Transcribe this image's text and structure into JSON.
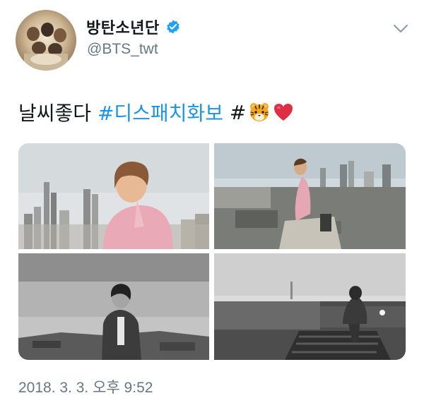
{
  "tweet": {
    "display_name": "방탄소년단",
    "handle": "@BTS_twt",
    "text_plain": "날씨좋다",
    "hashtag_1": "#디스패치화보",
    "hashtag_2": "#",
    "emojis": [
      "tiger-face",
      "red-heart"
    ],
    "timestamp": "2018. 3. 3. 오후 9:52",
    "photos": [
      {
        "name": "photo-rooftop-pink-hoodie",
        "style": "color"
      },
      {
        "name": "photo-rooftop-ledge-sky",
        "style": "color"
      },
      {
        "name": "photo-seated-blazer",
        "style": "black-and-white"
      },
      {
        "name": "photo-rooftop-silhouette",
        "style": "black-and-white"
      }
    ]
  },
  "colors": {
    "link": "#1b95e0",
    "secondary_text": "#657786",
    "verified_badge": "#1da1f2",
    "primary_text": "#14171a"
  },
  "icons": {
    "verified": "verified-badge-icon",
    "menu": "chevron-down-icon"
  }
}
